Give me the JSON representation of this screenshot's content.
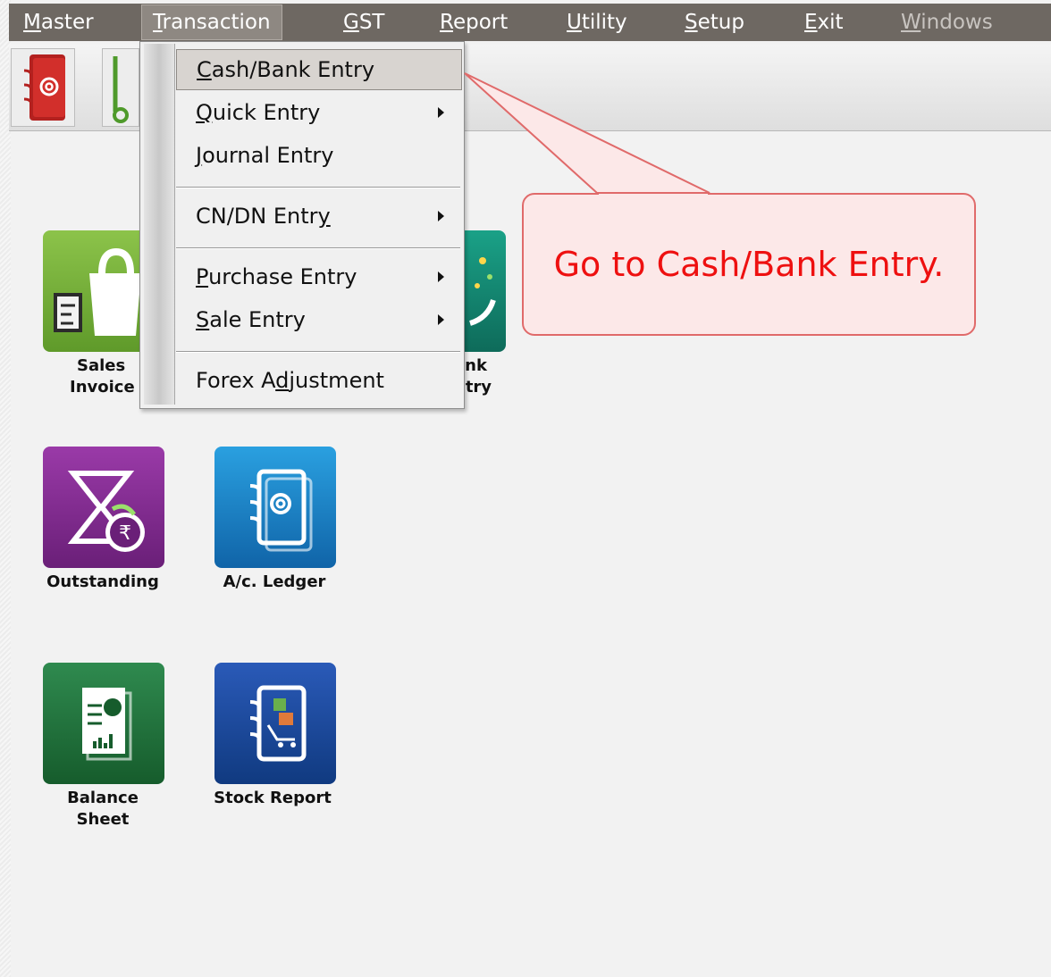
{
  "menubar": {
    "items": [
      {
        "label": "Master",
        "mnemonic": "M",
        "rest": "aster"
      },
      {
        "label": "Transaction",
        "mnemonic": "T",
        "rest": "ransaction"
      },
      {
        "label": "GST",
        "mnemonic": "G",
        "rest": "ST"
      },
      {
        "label": "Report",
        "mnemonic": "R",
        "rest": "eport"
      },
      {
        "label": "Utility",
        "mnemonic": "U",
        "rest": "tility"
      },
      {
        "label": "Setup",
        "mnemonic": "S",
        "rest": "etup"
      },
      {
        "label": "Exit",
        "mnemonic": "E",
        "rest": "xit"
      },
      {
        "label": "Windows",
        "mnemonic": "W",
        "rest": "indows"
      }
    ],
    "active": "Transaction"
  },
  "transaction_menu": {
    "items": [
      {
        "pre": "",
        "mnemonic": "C",
        "post": "ash/Bank Entry",
        "submenu": false,
        "highlighted": true
      },
      {
        "pre": "",
        "mnemonic": "Q",
        "post": "uick Entry",
        "submenu": true
      },
      {
        "pre": "",
        "mnemonic": "J",
        "post": "ournal Entry",
        "submenu": false
      },
      {
        "pre": "CN/DN Entr",
        "mnemonic": "y",
        "post": "",
        "submenu": true
      },
      {
        "pre": "",
        "mnemonic": "P",
        "post": "urchase Entry",
        "submenu": true
      },
      {
        "pre": "",
        "mnemonic": "S",
        "post": "ale Entry",
        "submenu": true
      },
      {
        "pre": "Forex A",
        "mnemonic": "d",
        "post": "justment",
        "submenu": false
      }
    ]
  },
  "desktop": {
    "sales_invoice": {
      "line1": "Sales",
      "line2": "Invoice"
    },
    "cash_bank": {
      "line1": "ank",
      "line2": "ntry"
    },
    "outstanding": {
      "line1": "Outstanding"
    },
    "ac_ledger": {
      "line1": "A/c. Ledger"
    },
    "balance_sheet": {
      "line1": "Balance",
      "line2": "Sheet"
    },
    "stock_report": {
      "line1": "Stock Report"
    }
  },
  "callout": {
    "text": "Go to Cash/Bank Entry."
  },
  "colors": {
    "menubar": "#6e6862",
    "callout_text": "#ee1010",
    "callout_border": "#e06a6a",
    "callout_fill": "#fce8e8"
  }
}
